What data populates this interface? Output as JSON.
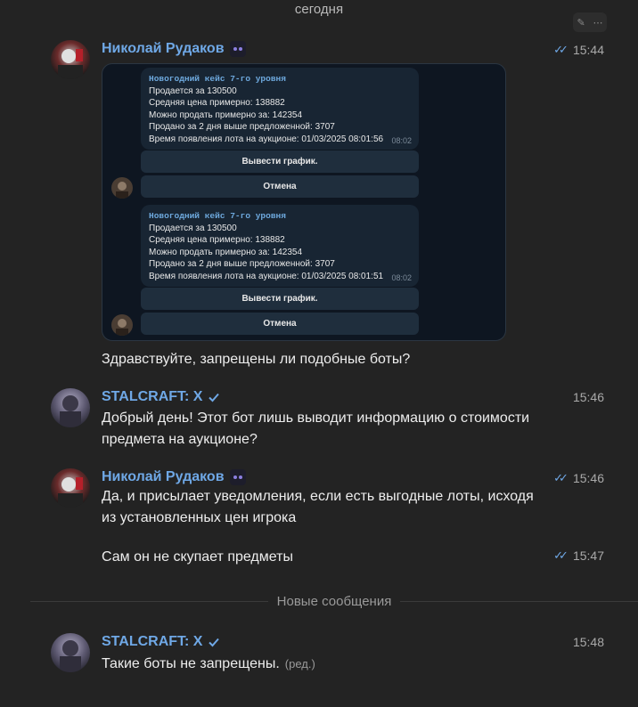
{
  "day_label": "сегодня",
  "new_messages_label": "Новые сообщения",
  "accent": "#6fa8e6",
  "icons": [
    "pencil-icon",
    "more-icon",
    "double-check-icon",
    "verified-icon"
  ],
  "messages": [
    {
      "author": "Николай Рудаков",
      "time": "15:44",
      "text": "Здравствуйте, запрещены ли подобные боты?",
      "attachment": {
        "cards": [
          {
            "title": "Новогодний кейс 7-го уровня",
            "lines": [
              "Продается за 130500",
              "Средняя цена примерно: 138882",
              "Можно продать примерно за: 142354",
              "Продано за 2 дня выше предложенной: 3707",
              "Время появления лота на аукционе: 01/03/2025 08:01:56"
            ],
            "time": "08:02",
            "btn_chart": "Вывести график.",
            "btn_cancel": "Отмена"
          },
          {
            "title": "Новогодний кейс 7-го уровня",
            "lines": [
              "Продается за 130500",
              "Средняя цена примерно: 138882",
              "Можно продать примерно за: 142354",
              "Продано за 2 дня выше предложенной: 3707",
              "Время появления лота на аукционе: 01/03/2025 08:01:51"
            ],
            "time": "08:02",
            "btn_chart": "Вывести график.",
            "btn_cancel": "Отмена"
          }
        ]
      }
    },
    {
      "author": "STALCRAFT: X",
      "time": "15:46",
      "text_line1": "Добрый день! Этот бот лишь выводит информацию о стоимости",
      "text_line2": "предмета на аукционе?"
    },
    {
      "author": "Николай Рудаков",
      "time": "15:46",
      "text_line1": "Да, и присылает уведомления, если есть выгодные лоты, исходя",
      "text_line2": "из установленных цен игрока"
    },
    {
      "time": "15:47",
      "text": "Сам он не скупает предметы"
    },
    {
      "author": "STALCRAFT: X",
      "time": "15:48",
      "text": "Такие боты не запрещены.",
      "edited": "(ред.)"
    }
  ]
}
